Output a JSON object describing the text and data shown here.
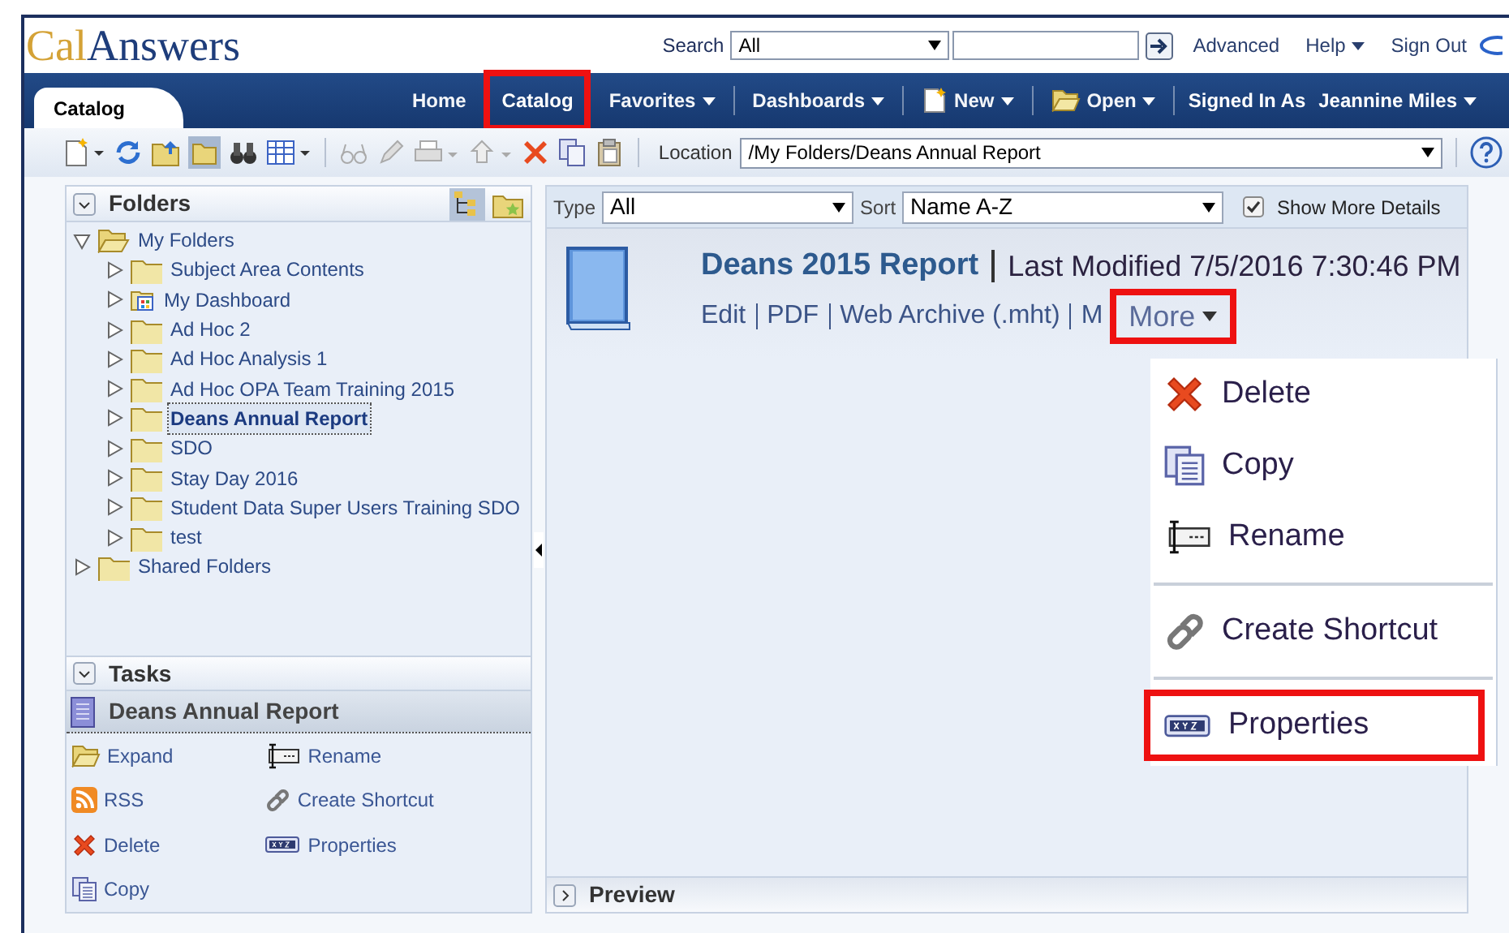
{
  "header": {
    "logo_first": "Cal",
    "logo_second": "Answers",
    "search_label": "Search",
    "search_scope": "All",
    "links": [
      {
        "label": "Advanced",
        "dropdown": false
      },
      {
        "label": "Help",
        "dropdown": true
      },
      {
        "label": "Sign Out",
        "dropdown": false
      }
    ]
  },
  "nav": {
    "tab": "Catalog",
    "items": [
      {
        "label": "Home",
        "dropdown": false,
        "selected": false,
        "highlighted": false
      },
      {
        "label": "Catalog",
        "dropdown": false,
        "selected": true,
        "highlighted": true
      },
      {
        "label": "Favorites",
        "dropdown": true,
        "selected": false,
        "highlighted": false
      },
      {
        "label": "Dashboards",
        "dropdown": true,
        "selected": false,
        "highlighted": false
      },
      {
        "label": "New",
        "dropdown": true,
        "selected": false,
        "highlighted": false,
        "kind": "new"
      },
      {
        "label": "Open",
        "dropdown": true,
        "selected": false,
        "highlighted": false,
        "kind": "open"
      }
    ],
    "signed_in_label": "Signed In As",
    "user": "Jeannine Miles"
  },
  "toolbar": {
    "location_label": "Location",
    "location": "/My Folders/Deans Annual Report"
  },
  "folders": {
    "title": "Folders",
    "tree": [
      {
        "label": "My Folders",
        "kind": "folder",
        "expanded": true,
        "selected": false,
        "children": [
          {
            "label": "Subject Area Contents",
            "kind": "folder",
            "expanded": false,
            "selected": false
          },
          {
            "label": "My Dashboard",
            "kind": "dashboard",
            "expanded": false,
            "selected": false
          },
          {
            "label": "Ad Hoc 2",
            "kind": "folder",
            "expanded": false,
            "selected": false
          },
          {
            "label": "Ad Hoc Analysis 1",
            "kind": "folder",
            "expanded": false,
            "selected": false
          },
          {
            "label": "Ad Hoc OPA Team Training 2015",
            "kind": "folder",
            "expanded": false,
            "selected": false
          },
          {
            "label": "Deans Annual Report",
            "kind": "folder",
            "expanded": false,
            "selected": true
          },
          {
            "label": "SDO",
            "kind": "folder",
            "expanded": false,
            "selected": false
          },
          {
            "label": "Stay Day 2016",
            "kind": "folder",
            "expanded": false,
            "selected": false
          },
          {
            "label": "Student Data Super Users Training SDO",
            "kind": "folder",
            "expanded": false,
            "selected": false
          },
          {
            "label": "test",
            "kind": "folder",
            "expanded": false,
            "selected": false
          }
        ]
      },
      {
        "label": "Shared Folders",
        "kind": "folder",
        "expanded": false,
        "selected": false
      }
    ]
  },
  "tasks": {
    "title": "Tasks",
    "item": "Deans Annual Report",
    "actions": [
      {
        "label": "Expand",
        "kind": "expand"
      },
      {
        "label": "RSS",
        "kind": "rss"
      },
      {
        "label": "Delete",
        "kind": "delete"
      },
      {
        "label": "Copy",
        "kind": "copy"
      },
      {
        "label": "Rename",
        "kind": "rename"
      },
      {
        "label": "Create Shortcut",
        "kind": "shortcut"
      },
      {
        "label": "Properties",
        "kind": "properties"
      }
    ]
  },
  "filter": {
    "type_label": "Type",
    "type": "All",
    "sort_label": "Sort",
    "sort": "Name A-Z",
    "details_label": "Show More Details",
    "details_checked": true
  },
  "item": {
    "title": "Deans 2015 Report",
    "modified": "Last Modified 7/5/2016 7:30:46 PM",
    "links": [
      "Edit",
      "PDF",
      "Web Archive (.mht)",
      "M"
    ],
    "more": {
      "label": "More",
      "highlighted": true
    }
  },
  "menu": [
    {
      "label": "Delete",
      "kind": "delete",
      "separator_before": false,
      "highlighted": false
    },
    {
      "label": "Copy",
      "kind": "copy",
      "separator_before": false,
      "highlighted": false
    },
    {
      "label": "Rename",
      "kind": "rename",
      "separator_before": false,
      "highlighted": false
    },
    {
      "label": "Create Shortcut",
      "kind": "shortcut",
      "separator_before": true,
      "highlighted": false
    },
    {
      "label": "Properties",
      "kind": "properties",
      "separator_before": true,
      "highlighted": true
    }
  ],
  "preview": {
    "title": "Preview"
  }
}
